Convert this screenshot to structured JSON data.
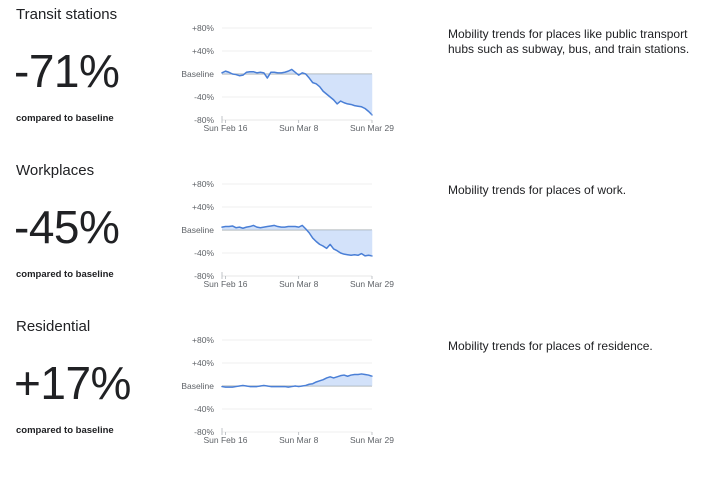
{
  "sections": [
    {
      "title": "Transit stations",
      "value": "-71%",
      "compared": "compared to baseline",
      "description": "Mobility trends for places like public transport hubs such as subway, bus, and train stations."
    },
    {
      "title": "Workplaces",
      "value": "-45%",
      "compared": "compared to baseline",
      "description": "Mobility trends for places of work."
    },
    {
      "title": "Residential",
      "value": "+17%",
      "compared": "compared to baseline",
      "description": "Mobility trends for places of residence."
    }
  ],
  "colors": {
    "line": "#4a7fd6",
    "fill": "#d3e2fa",
    "grid": "#e0e0e0",
    "baseline": "#9aa0a6"
  },
  "chart_data": [
    {
      "type": "area",
      "title": "Transit stations",
      "y_tick_labels": [
        "+80%",
        "+40%",
        "Baseline",
        "-40%",
        "-80%"
      ],
      "y_ticks": [
        80,
        40,
        0,
        -40,
        -80
      ],
      "x_tick_labels": [
        "Sun Feb 16",
        "Sun Mar 8",
        "Sun Mar 29"
      ],
      "x_tick_days": [
        1,
        22,
        43
      ],
      "ylim": [
        -80,
        80
      ],
      "grid": true,
      "x": [
        0,
        1,
        2,
        3,
        4,
        5,
        6,
        7,
        8,
        9,
        10,
        11,
        12,
        13,
        14,
        15,
        16,
        17,
        18,
        19,
        20,
        21,
        22,
        23,
        24,
        25,
        26,
        27,
        28,
        29,
        30,
        31,
        32,
        33,
        34,
        35,
        36,
        37,
        38,
        39,
        40,
        41,
        42,
        43
      ],
      "values": [
        2,
        5,
        3,
        0,
        -1,
        -3,
        -2,
        3,
        4,
        4,
        2,
        3,
        2,
        -7,
        3,
        3,
        2,
        2,
        3,
        5,
        8,
        3,
        -2,
        2,
        0,
        -7,
        -15,
        -17,
        -22,
        -30,
        -35,
        -40,
        -45,
        -52,
        -47,
        -50,
        -52,
        -53,
        -55,
        -56,
        -57,
        -60,
        -65,
        -71
      ]
    },
    {
      "type": "area",
      "title": "Workplaces",
      "y_tick_labels": [
        "+80%",
        "+40%",
        "Baseline",
        "-40%",
        "-80%"
      ],
      "y_ticks": [
        80,
        40,
        0,
        -40,
        -80
      ],
      "x_tick_labels": [
        "Sun Feb 16",
        "Sun Mar 8",
        "Sun Mar 29"
      ],
      "x_tick_days": [
        1,
        22,
        43
      ],
      "ylim": [
        -80,
        80
      ],
      "grid": true,
      "x": [
        0,
        1,
        2,
        3,
        4,
        5,
        6,
        7,
        8,
        9,
        10,
        11,
        12,
        13,
        14,
        15,
        16,
        17,
        18,
        19,
        20,
        21,
        22,
        23,
        24,
        25,
        26,
        27,
        28,
        29,
        30,
        31,
        32,
        33,
        34,
        35,
        36,
        37,
        38,
        39,
        40,
        41,
        42,
        43
      ],
      "values": [
        5,
        6,
        6,
        7,
        4,
        5,
        3,
        5,
        6,
        8,
        5,
        4,
        5,
        6,
        7,
        8,
        6,
        5,
        5,
        6,
        6,
        6,
        5,
        8,
        2,
        -5,
        -14,
        -20,
        -25,
        -28,
        -32,
        -25,
        -33,
        -36,
        -40,
        -42,
        -43,
        -44,
        -43,
        -44,
        -41,
        -45,
        -44,
        -45
      ]
    },
    {
      "type": "area",
      "title": "Residential",
      "y_tick_labels": [
        "+80%",
        "+40%",
        "Baseline",
        "-40%"
      ],
      "y_ticks": [
        80,
        40,
        0,
        -40
      ],
      "bottom_tick_label": "-80%",
      "x_tick_labels": [
        "Sun Feb 16",
        "Sun Mar 8",
        "Sun Mar 29"
      ],
      "x_tick_days": [
        1,
        22,
        43
      ],
      "ylim": [
        -80,
        80
      ],
      "grid": true,
      "x": [
        0,
        1,
        2,
        3,
        4,
        5,
        6,
        7,
        8,
        9,
        10,
        11,
        12,
        13,
        14,
        15,
        16,
        17,
        18,
        19,
        20,
        21,
        22,
        23,
        24,
        25,
        26,
        27,
        28,
        29,
        30,
        31,
        32,
        33,
        34,
        35,
        36,
        37,
        38,
        39,
        40,
        41,
        42,
        43
      ],
      "values": [
        -1,
        -2,
        -2,
        -2,
        -1,
        0,
        1,
        0,
        -1,
        -1,
        -1,
        0,
        1,
        0,
        -1,
        -1,
        -1,
        -1,
        -1,
        -2,
        -1,
        0,
        -1,
        0,
        1,
        3,
        4,
        7,
        9,
        11,
        14,
        16,
        14,
        16,
        18,
        19,
        17,
        19,
        20,
        20,
        21,
        20,
        19,
        17
      ]
    }
  ]
}
